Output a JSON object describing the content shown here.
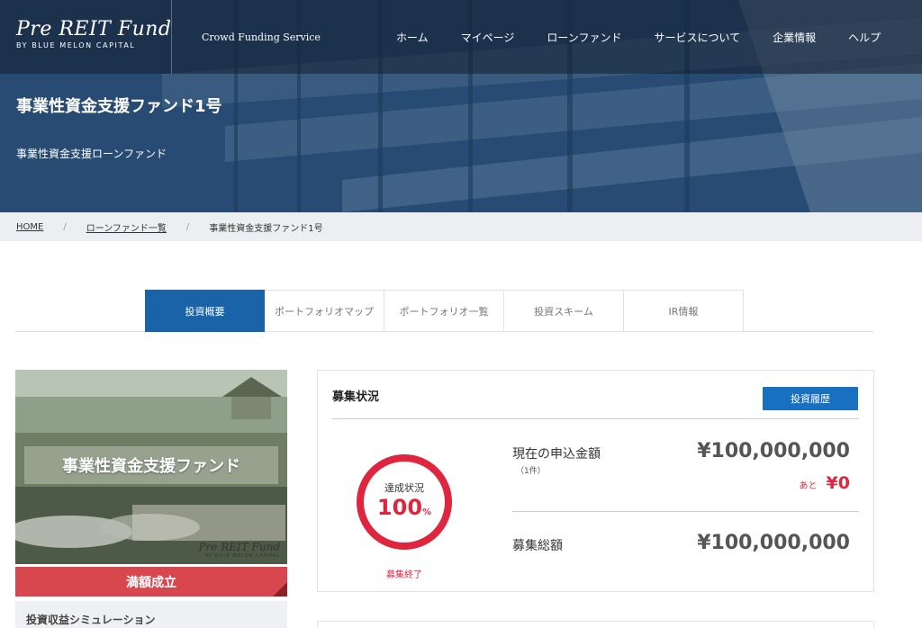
{
  "header": {
    "logo_main": "Pre REIT Fund",
    "logo_sub": "BY BLUE MELON CAPITAL",
    "tagline": "Crowd Funding Service",
    "nav": [
      "ホーム",
      "マイページ",
      "ローンファンド",
      "サービスについて",
      "企業情報",
      "ヘルプ"
    ]
  },
  "hero": {
    "title": "事業性資金支援ファンド1号",
    "subtitle": "事業性資金支援ローンファンド"
  },
  "breadcrumb": {
    "home": "HOME",
    "list": "ローンファンド一覧",
    "current": "事業性資金支援ファンド1号"
  },
  "tabs": [
    {
      "label": "投資概要",
      "active": true
    },
    {
      "label": "ポートフォリオマップ",
      "active": false
    },
    {
      "label": "ポートフォリオ一覧",
      "active": false
    },
    {
      "label": "投資スキーム",
      "active": false
    },
    {
      "label": "IR情報",
      "active": false
    }
  ],
  "fund_card": {
    "image_title": "事業性資金支援ファンド",
    "image_logo_main": "Pre REIT Fund",
    "image_logo_sub": "BY BLUE MELON CAPITAL",
    "status": "満額成立",
    "simulation": "投資収益シミュレーション"
  },
  "recruitment": {
    "title": "募集状況",
    "history_button": "投資履歴",
    "gauge_label": "達成状況",
    "gauge_value": "100",
    "gauge_unit": "%",
    "gauge_fraction": 1.0,
    "gauge_status": "募集終了",
    "current_label": "現在の申込金額",
    "current_count": "（1件）",
    "current_amount": "¥100,000,000",
    "remaining_prefix": "あと",
    "remaining_amount": "¥0",
    "total_label": "募集総額",
    "total_amount": "¥100,000,000"
  },
  "colors": {
    "primary": "#1a63a8",
    "accent_red": "#e0263f",
    "status_red": "#d9474e"
  }
}
